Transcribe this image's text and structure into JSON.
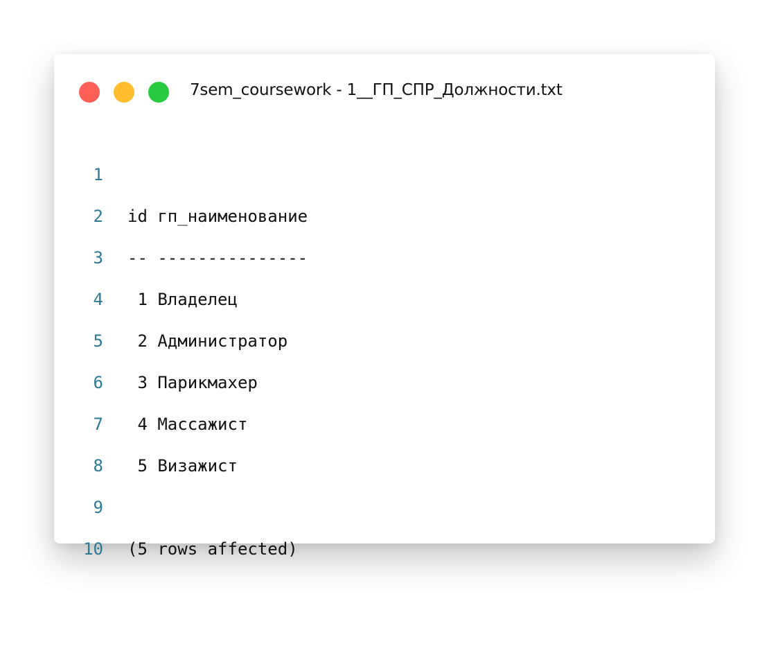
{
  "window": {
    "title": "7sem_coursework - 1__ГП_СПР_Должности.txt",
    "controls": {
      "close_color": "#ff5f56",
      "minimize_color": "#ffbd2e",
      "maximize_color": "#27c93f"
    }
  },
  "editor": {
    "lines": [
      {
        "number": "1",
        "text": "id гп_наименование"
      },
      {
        "number": "2",
        "text": "-- ---------------"
      },
      {
        "number": "3",
        "text": " 1 Владелец"
      },
      {
        "number": "4",
        "text": " 2 Администратор"
      },
      {
        "number": "5",
        "text": " 3 Парикмахер"
      },
      {
        "number": "6",
        "text": " 4 Массажист"
      },
      {
        "number": "7",
        "text": " 5 Визажист"
      },
      {
        "number": "8",
        "text": ""
      },
      {
        "number": "9",
        "text": "(5 rows affected)"
      },
      {
        "number": "10",
        "text": ""
      }
    ]
  }
}
